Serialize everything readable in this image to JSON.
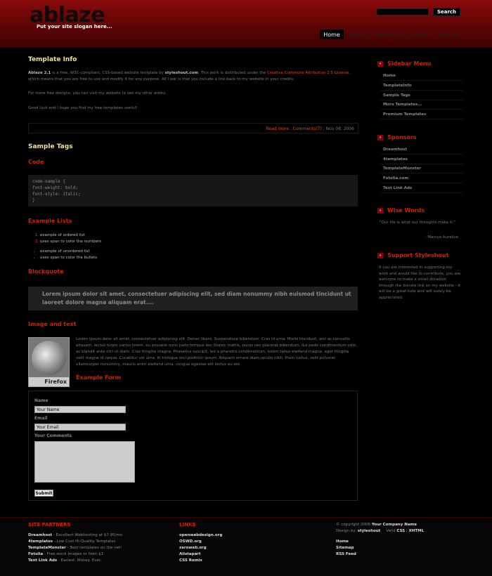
{
  "site": {
    "logo": "ablaze",
    "slogan": "Put your site slogan here..."
  },
  "search": {
    "button_label": "Search"
  },
  "nav": [
    {
      "label": "Home",
      "active": true
    },
    {
      "label": "News",
      "active": false
    },
    {
      "label": "Downloads",
      "active": false
    },
    {
      "label": "Support",
      "active": false
    },
    {
      "label": "About",
      "active": false
    }
  ],
  "template_info": {
    "title": "Template Info",
    "p1_name": "Ablaze 2.1",
    "p1_a": " is a free, W3C-compliant, CSS-based website template by ",
    "p1_site": "styleshout.com",
    "p1_b": ". This work is distributed under the ",
    "p1_license": "Creative Commons Attribution 2.5 License",
    "p1_c": ", which means that you are free to use and modify it for any purpose. All I ask is that you include a link back to my website in your credits.",
    "p2": "For more free designs, you can visit my website to see my other works.",
    "p3": "Good luck and I hope you find my free templates useful!",
    "read_more": "Read more",
    "sep1": " : ",
    "comments": "Comments(7)",
    "sep2": " : ",
    "date": "Nov 08, 2006"
  },
  "sample_tags": {
    "title": "Sample Tags",
    "code_heading": "Code",
    "code_lines": [
      "code-sample {",
      "font-weight: bold;",
      "font-style: italic;",
      "}"
    ],
    "lists_heading": "Example Lists",
    "ordered": [
      "example of ordered list",
      "uses span to color the numbers"
    ],
    "unordered": [
      "example of unordered list",
      "uses span to color the bullets"
    ],
    "blockquote_heading": "Blockquote",
    "blockquote_text": "Lorem ipsum dolor sit amet, consectetuer adipiscing elit, sed diam nonummy nibh euismod tincidunt ut laoreet dolore magna aliquam erat....",
    "image_heading": "Image and text",
    "image_caption": "Firefox",
    "image_text": "Lorem ipsum dolor sit amet, consectetuer adipiscing elit. Donec libero. Suspendisse bibendum. Cras id urna. Morbi tincidunt, orci ac convallis aliquam, lectus turpis varius lorem, eu posuere nunc justo tempus leo. Donec mattis, purus nec placerat bibendum, dui pede condimentum odio, ac blandit ante orci ut diam. Cras fringilla magna. Phasellus suscipit, leo a pharetra condimentum, lorem tellus eleifend magna, eget fringilla velit magna id neque. Curabitur vel urna. In tristique orci porttitor ipsum. Aliquam ornare diam iaculis nibh. Proin luctus, velit pulvinar ullamcorper nonummy, mauris enim eleifend urna, congue egestas elit lectus eu est.",
    "form_heading": "Example Form"
  },
  "form": {
    "name_label": "Name",
    "name_value": "Your Name",
    "email_label": "Email",
    "email_value": "Your Email",
    "comments_label": "Your Comments",
    "submit_label": "Submit"
  },
  "sidebar": {
    "menu_title": "Sidebar Menu",
    "menu_items": [
      "Home",
      "TemplateInfo",
      "Sample Tags",
      "More Templates...",
      "Premium Templates"
    ],
    "sponsors_title": "Sponsors",
    "sponsors": [
      "Dreamhost",
      "4templates",
      "TemplateMonster",
      "Fotolia.com",
      "Text Link Ads"
    ],
    "wise_title": "Wise Words",
    "wise_quote": "\"Our life is what our thoughts make it.\"",
    "wise_author": "- Marcus Aurelius",
    "support_title": "Support Styleshout",
    "support_text": "If you are interested in supporting my work and would like to contribute, you are welcome to make a small donation through the donate link on my website - it will be a great help and will surely be appreciated."
  },
  "footer": {
    "partners_title": "SITE PARTNERS",
    "partners": [
      {
        "name": "Dreamhost",
        "desc": " - Excellent Webhosting at $7.95/mo"
      },
      {
        "name": "4templates",
        "desc": " - Low Cost Hi-Quality Templates"
      },
      {
        "name": "TemplateMonster",
        "desc": " - Best templates on the net!"
      },
      {
        "name": "Fotolia",
        "desc": " - Free stock images or from $1"
      },
      {
        "name": "Text Link Ads",
        "desc": " - Easiest. Money. Ever."
      }
    ],
    "links_title": "LINKS",
    "links": [
      "openwebdesign.org",
      "OSWD.org",
      "zeroweb.org",
      "Alistapart",
      "CSS Remix"
    ],
    "copyright_pre": "© copyright 2006 ",
    "copyright_company": "Your Company Name",
    "design_pre": "Design by: ",
    "design_by": "styleshout",
    "valid_pre": "Valid ",
    "valid_css": "CSS",
    "valid_sep": " | ",
    "valid_xhtml": "XHTML",
    "bottom_links": [
      "Home",
      "Sitemap",
      "RSS Feed"
    ]
  }
}
